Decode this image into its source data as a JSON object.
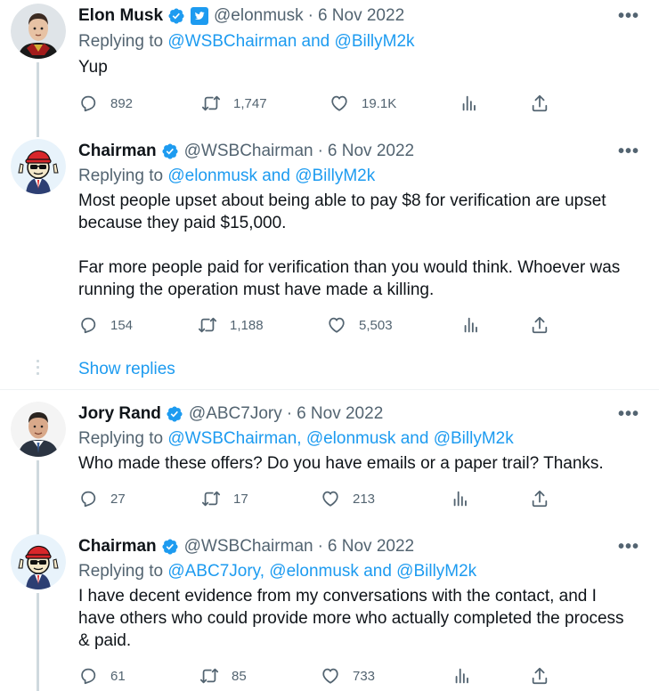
{
  "tweets": [
    {
      "name": "Elon Musk",
      "handle": "@elonmusk",
      "date": "6 Nov 2022",
      "replying_prefix": "Replying to",
      "replying_to": "@WSBChairman and @BillyM2k",
      "text": "Yup",
      "replies": "892",
      "retweets": "1,747",
      "likes": "19.1K"
    },
    {
      "name": "Chairman",
      "handle": "@WSBChairman",
      "date": "6 Nov 2022",
      "replying_prefix": "Replying to",
      "replying_to": "@elonmusk and @BillyM2k",
      "text": "Most people upset about being able to pay $8 for verification are upset\nbecause they paid $15,000.\n\nFar more people paid for verification than you would think. Whoever was\nrunning the operation must have made a killing.",
      "replies": "154",
      "retweets": "1,188",
      "likes": "5,503"
    },
    {
      "name": "Jory Rand",
      "handle": "@ABC7Jory",
      "date": "6 Nov 2022",
      "replying_prefix": "Replying to",
      "replying_to": "@WSBChairman, @elonmusk and @BillyM2k",
      "text": "Who made these offers? Do you have emails or a paper trail? Thanks.",
      "replies": "27",
      "retweets": "17",
      "likes": "213"
    },
    {
      "name": "Chairman",
      "handle": "@WSBChairman",
      "date": "6 Nov 2022",
      "replying_prefix": "Replying to",
      "replying_to": "@ABC7Jory, @elonmusk and @BillyM2k",
      "text": "I have decent evidence from my conversations with the contact, and I\nhave others who could provide more who actually completed the process\n& paid.",
      "replies": "61",
      "retweets": "85",
      "likes": "733"
    }
  ],
  "show_replies": "Show replies",
  "colors": {
    "accent": "#1d9bf0",
    "muted": "#536471",
    "text": "#0f1419",
    "thread_line": "#cfd9de"
  },
  "icons": [
    "verified-badge-icon",
    "twitter-bird-icon",
    "more-icon",
    "reply-icon",
    "retweet-icon",
    "like-icon",
    "views-icon",
    "share-icon"
  ]
}
